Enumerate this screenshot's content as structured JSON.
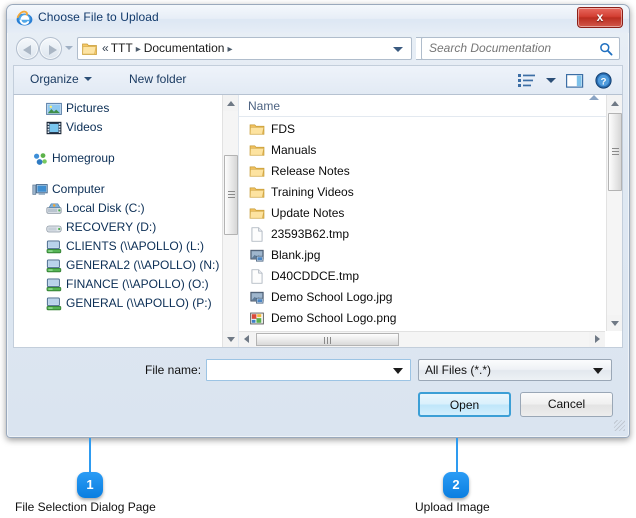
{
  "window": {
    "title": "Choose File to Upload",
    "app_icon": "internet-explorer-icon",
    "close_label": "x"
  },
  "address_bar": {
    "back_icon": "back-arrow-icon",
    "forward_icon": "forward-arrow-icon",
    "recent_icon": "chevron-down-icon",
    "folder_icon": "folder-icon",
    "overflow": "«",
    "crumb1": "TTT",
    "crumb2": "Documentation",
    "sep": "▸",
    "dropdown_icon": "chevron-down-icon",
    "refresh_icon": "refresh-icon"
  },
  "search": {
    "placeholder": "Search Documentation",
    "icon": "search-icon"
  },
  "toolbar": {
    "organize_label": "Organize",
    "new_folder_label": "New folder",
    "view_icon": "view-list-icon",
    "view_caret_icon": "chevron-down-icon",
    "preview_pane_icon": "preview-pane-icon",
    "help_icon": "help-circle-icon"
  },
  "sidebar": {
    "items": [
      {
        "label": "Pictures",
        "icon": "pictures-icon",
        "indent": 2
      },
      {
        "label": "Videos",
        "icon": "videos-icon",
        "indent": 2
      },
      {
        "label": "Homegroup",
        "icon": "homegroup-icon",
        "indent": 1
      },
      {
        "label": "Computer",
        "icon": "computer-icon",
        "indent": 1
      },
      {
        "label": "Local Disk (C:)",
        "icon": "local-disk-icon",
        "indent": 2
      },
      {
        "label": "RECOVERY (D:)",
        "icon": "drive-icon",
        "indent": 2
      },
      {
        "label": "CLIENTS (\\\\APOLLO) (L:)",
        "icon": "network-drive-icon",
        "indent": 2
      },
      {
        "label": "GENERAL2 (\\\\APOLLO) (N:)",
        "icon": "network-drive-icon",
        "indent": 2
      },
      {
        "label": "FINANCE (\\\\APOLLO) (O:)",
        "icon": "network-drive-icon",
        "indent": 2
      },
      {
        "label": "GENERAL (\\\\APOLLO) (P:)",
        "icon": "network-drive-icon",
        "indent": 2
      }
    ]
  },
  "file_list": {
    "column_header": "Name",
    "sort_indicator_icon": "sort-ascending-icon",
    "items": [
      {
        "label": "FDS",
        "icon": "folder-icon"
      },
      {
        "label": "Manuals",
        "icon": "folder-icon"
      },
      {
        "label": "Release Notes",
        "icon": "folder-icon"
      },
      {
        "label": "Training Videos",
        "icon": "folder-icon"
      },
      {
        "label": "Update Notes",
        "icon": "folder-icon"
      },
      {
        "label": "23593B62.tmp",
        "icon": "blank-file-icon"
      },
      {
        "label": "Blank.jpg",
        "icon": "jpg-image-icon"
      },
      {
        "label": "D40CDDCE.tmp",
        "icon": "blank-file-icon"
      },
      {
        "label": "Demo School Logo.jpg",
        "icon": "jpg-image-icon"
      },
      {
        "label": "Demo School Logo.png",
        "icon": "png-image-icon"
      }
    ]
  },
  "footer": {
    "filename_label": "File name:",
    "filename_value": "",
    "filename_placeholder": "",
    "filetype_value": "All Files (*.*)",
    "open_label": "Open",
    "cancel_label": "Cancel"
  },
  "callouts": [
    {
      "number": "1",
      "label": "File Selection Dialog Page"
    },
    {
      "number": "2",
      "label": "Upload Image"
    }
  ],
  "colors": {
    "accent": "#0a7ee0",
    "close_red": "#bb2d20",
    "focus_blue": "#3c9fd6"
  }
}
